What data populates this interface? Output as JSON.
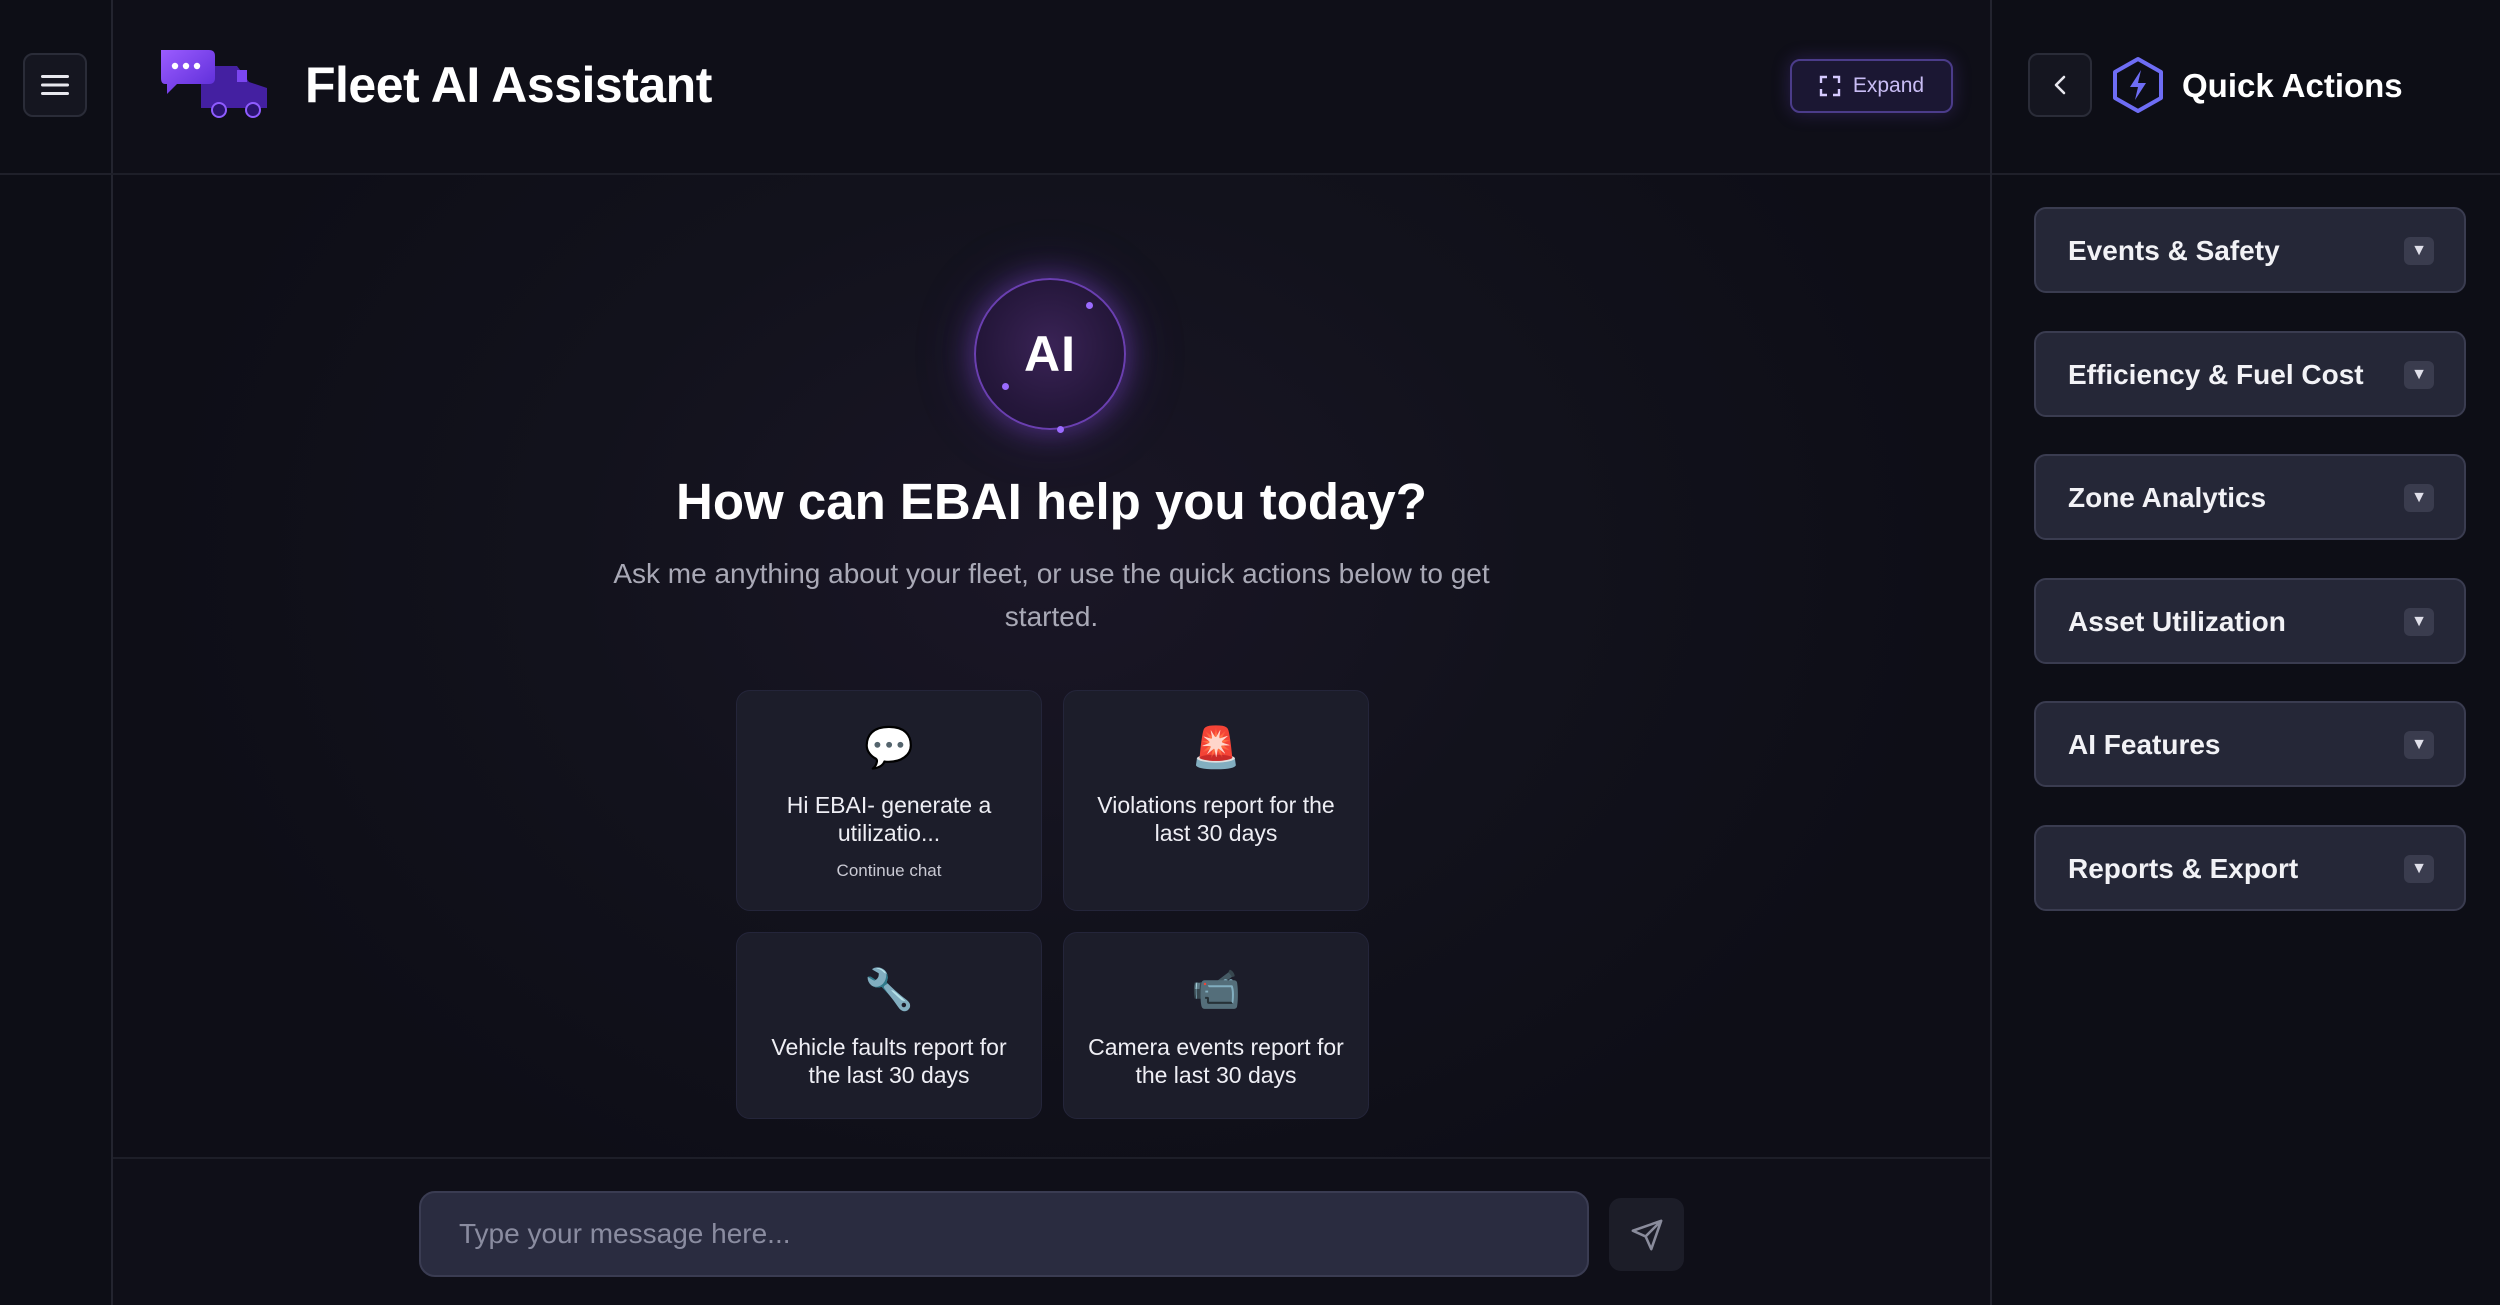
{
  "app": {
    "title": "Fleet AI Assistant",
    "expand_label": "Expand"
  },
  "hero": {
    "orb_label": "AI",
    "headline": "How can EBAI help you today?",
    "subline": "Ask me anything about your fleet, or use the quick actions below to get started."
  },
  "suggestions": [
    {
      "icon": "speech-bubble-icon",
      "glyph": "💬",
      "text": "Hi EBAI- generate a utilizatio...",
      "sub": "Continue chat"
    },
    {
      "icon": "siren-icon",
      "glyph": "🚨",
      "text": "Violations report for the last 30 days"
    },
    {
      "icon": "wrench-icon",
      "glyph": "🔧",
      "text": "Vehicle faults report for the last 30 days"
    },
    {
      "icon": "video-camera-icon",
      "glyph": "📹",
      "text": "Camera events report for the last 30 days"
    }
  ],
  "composer": {
    "placeholder": "Type your message here..."
  },
  "quick_actions": {
    "title": "Quick Actions",
    "items": [
      {
        "label": "Events & Safety"
      },
      {
        "label": "Efficiency & Fuel Cost"
      },
      {
        "label": "Zone Analytics"
      },
      {
        "label": "Asset Utilization"
      },
      {
        "label": "AI Features"
      },
      {
        "label": "Reports & Export"
      }
    ]
  },
  "colors": {
    "accent": "#7c4dff",
    "background": "#0c0c14",
    "panel_item": "#252737"
  }
}
